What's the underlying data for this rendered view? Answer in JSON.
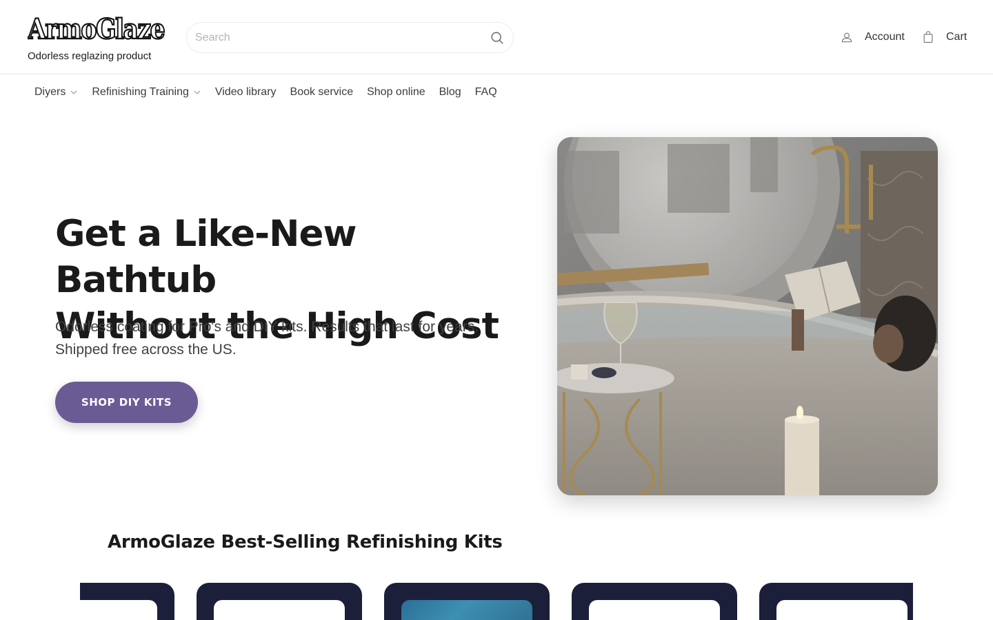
{
  "header": {
    "logo_text": "ArmoGlaze",
    "tagline": "Odorless reglazing product",
    "search_placeholder": "Search",
    "account_label": "Account",
    "cart_label": "Cart"
  },
  "nav": {
    "items": [
      {
        "label": "Diyers",
        "has_dropdown": true
      },
      {
        "label": "Refinishing Training",
        "has_dropdown": true
      },
      {
        "label": "Video library",
        "has_dropdown": false
      },
      {
        "label": "Book service",
        "has_dropdown": false
      },
      {
        "label": "Shop online",
        "has_dropdown": false
      },
      {
        "label": "Blog",
        "has_dropdown": false
      },
      {
        "label": "FAQ",
        "has_dropdown": false
      }
    ]
  },
  "hero": {
    "title_line1": "Get a Like-New Bathtub",
    "title_line2": "Without the High Cost",
    "subtitle": "Odorless coating for Pro's and DIY kits. Results that last for years. Shipped free across the US.",
    "cta_label": "SHOP DIY KITS",
    "image_subject": "woman reading a book in a freestanding bathtub with wine glass and candle"
  },
  "bestsellers": {
    "title": "ArmoGlaze Best-Selling Refinishing Kits"
  },
  "colors": {
    "accent": "#6b5b95",
    "card_dark": "#1c1f3a",
    "text": "#1a1a1a"
  }
}
